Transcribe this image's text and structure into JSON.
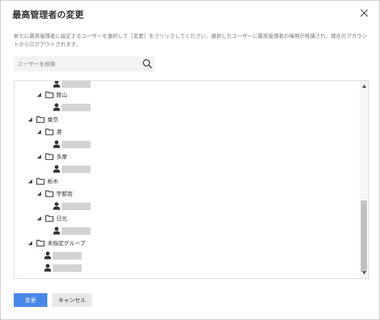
{
  "dialog": {
    "title": "最高管理者の変更",
    "description": "新たに最高管理者に設定するユーザーを選択して［変更］をクリックしてください。選択したユーザーに最高管理者の権限が移譲され、現在のアカウントからログアウトされます。"
  },
  "search": {
    "placeholder": "ユーザーを検索"
  },
  "tree": {
    "rows": [
      {
        "kind": "user",
        "level": 3,
        "label": ""
      },
      {
        "kind": "folder",
        "level": 2,
        "label": "館山"
      },
      {
        "kind": "user",
        "level": 3,
        "label": ""
      },
      {
        "kind": "folder",
        "level": 1,
        "label": "東京"
      },
      {
        "kind": "folder",
        "level": 2,
        "label": "港"
      },
      {
        "kind": "user",
        "level": 3,
        "label": ""
      },
      {
        "kind": "folder",
        "level": 2,
        "label": "多摩"
      },
      {
        "kind": "user",
        "level": 3,
        "label": ""
      },
      {
        "kind": "folder",
        "level": 1,
        "label": "栃木"
      },
      {
        "kind": "folder",
        "level": 2,
        "label": "宇都宮"
      },
      {
        "kind": "user",
        "level": 3,
        "label": ""
      },
      {
        "kind": "folder",
        "level": 2,
        "label": "日光"
      },
      {
        "kind": "user",
        "level": 3,
        "label": ""
      },
      {
        "kind": "folder",
        "level": 1,
        "label": "未指定グループ"
      },
      {
        "kind": "user",
        "level": 2,
        "label": ""
      },
      {
        "kind": "user",
        "level": 2,
        "label": ""
      }
    ]
  },
  "buttons": {
    "change": "変更",
    "cancel": "キャンセル"
  },
  "colors": {
    "primary": "#4a86e8",
    "redacted": "#d3d3d3"
  }
}
